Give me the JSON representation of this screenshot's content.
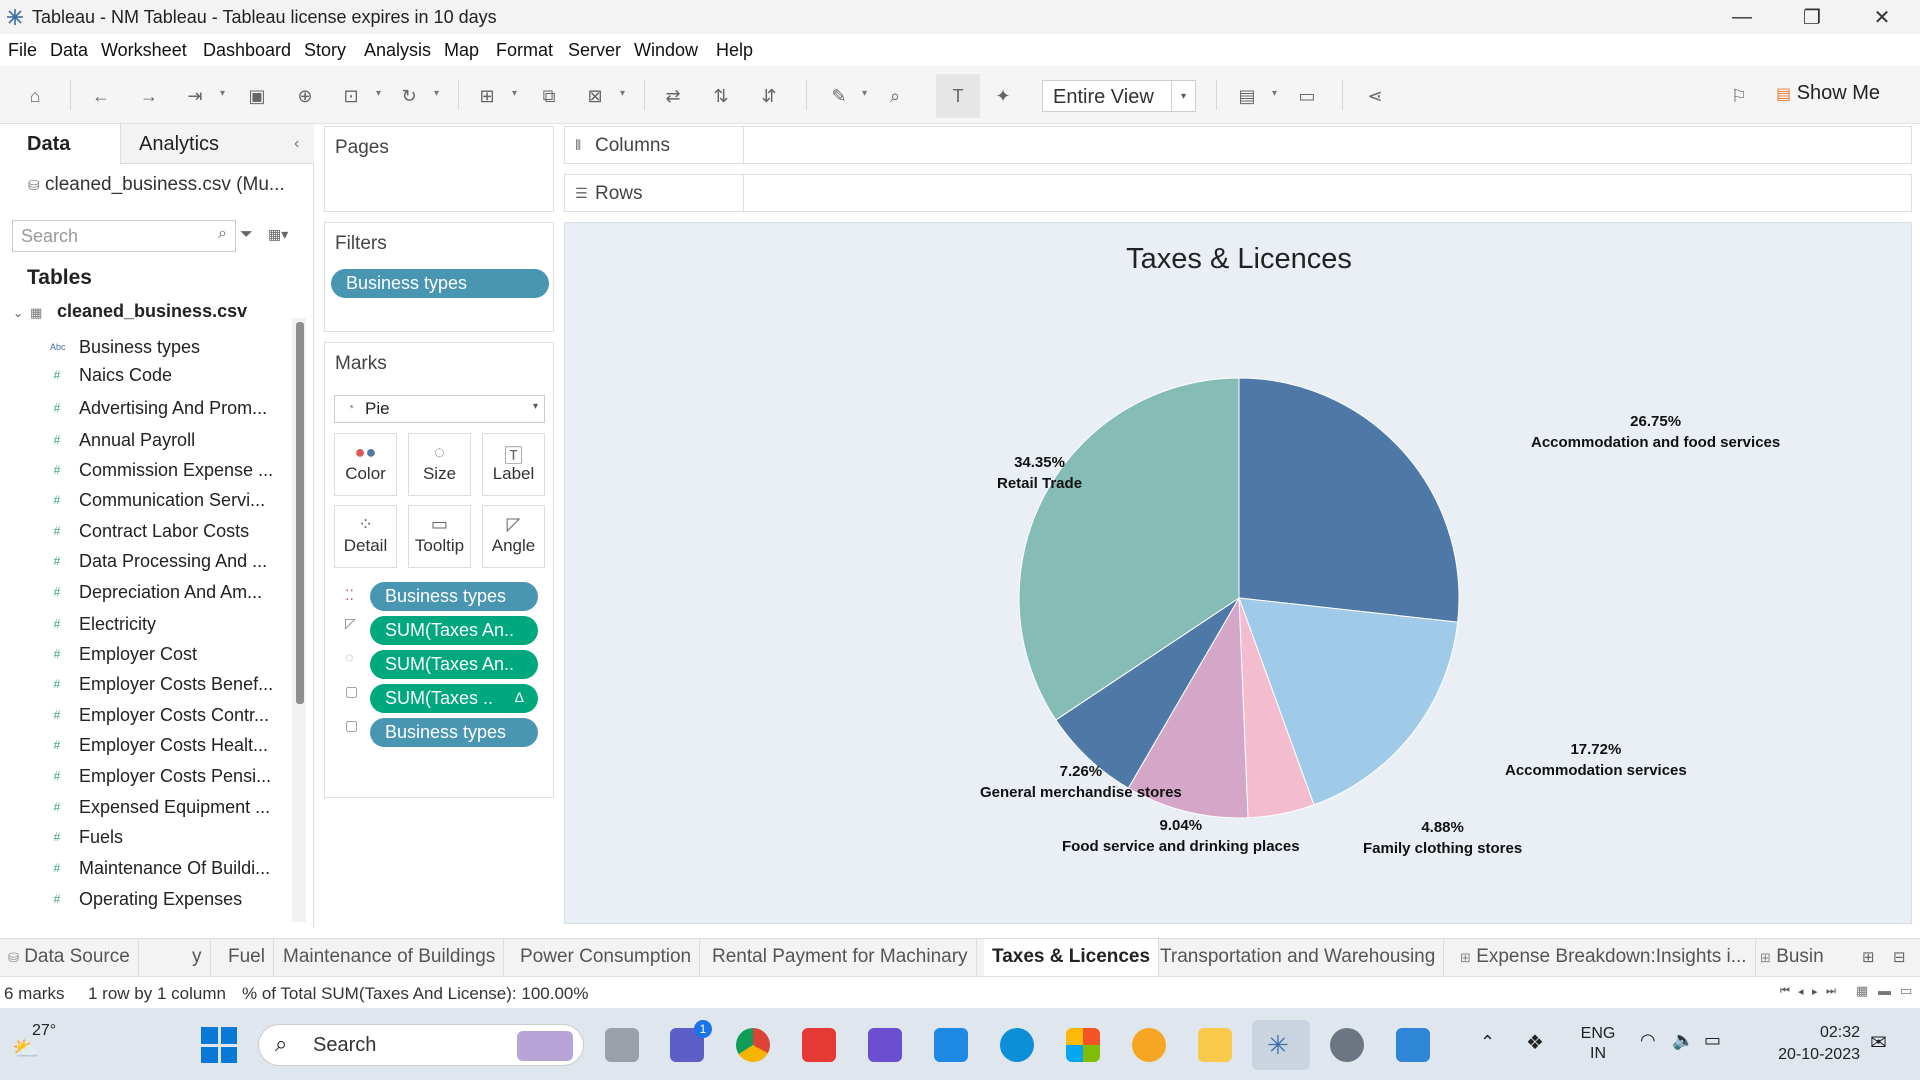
{
  "window": {
    "title": "Tableau - NM Tableau - Tableau license expires in 10 days",
    "minimize": "—",
    "restore": "❐",
    "close": "✕"
  },
  "menu": [
    "File",
    "Data",
    "Worksheet",
    "Dashboard",
    "Story",
    "Analysis",
    "Map",
    "Format",
    "Server",
    "Window",
    "Help"
  ],
  "toolbar": {
    "fit_value": "Entire View",
    "show_me": "Show Me"
  },
  "datapane": {
    "tab_data": "Data",
    "tab_analytics": "Analytics",
    "datasource": "cleaned_business.csv (Mu...",
    "search_placeholder": "Search",
    "tables_title": "Tables",
    "table_name": "cleaned_business.csv",
    "fields": [
      {
        "icon": "Abc",
        "label": "Business types"
      },
      {
        "icon": "#",
        "label": "Naics Code"
      },
      {
        "icon": "#",
        "label": "Advertising And Prom..."
      },
      {
        "icon": "#",
        "label": "Annual Payroll"
      },
      {
        "icon": "#",
        "label": "Commission Expense ..."
      },
      {
        "icon": "#",
        "label": "Communication Servi..."
      },
      {
        "icon": "#",
        "label": "Contract Labor Costs"
      },
      {
        "icon": "#",
        "label": "Data Processing And ..."
      },
      {
        "icon": "#",
        "label": "Depreciation And Am..."
      },
      {
        "icon": "#",
        "label": "Electricity"
      },
      {
        "icon": "#",
        "label": "Employer Cost"
      },
      {
        "icon": "#",
        "label": "Employer Costs Benef..."
      },
      {
        "icon": "#",
        "label": "Employer Costs Contr..."
      },
      {
        "icon": "#",
        "label": "Employer Costs Healt..."
      },
      {
        "icon": "#",
        "label": "Employer Costs Pensi..."
      },
      {
        "icon": "#",
        "label": "Expensed Equipment ..."
      },
      {
        "icon": "#",
        "label": "Fuels"
      },
      {
        "icon": "#",
        "label": "Maintenance Of Buildi..."
      },
      {
        "icon": "#",
        "label": "Operating Expenses"
      }
    ]
  },
  "shelves": {
    "pages": "Pages",
    "filters": "Filters",
    "filter_pill": "Business types",
    "marks": "Marks",
    "mark_type": "Pie",
    "mark_buttons": [
      "Color",
      "Size",
      "Label",
      "Detail",
      "Tooltip",
      "Angle"
    ],
    "mark_pills": [
      {
        "label": "Business types",
        "kind": "blue",
        "icon": "color"
      },
      {
        "label": "SUM(Taxes An..",
        "kind": "green",
        "icon": "angle"
      },
      {
        "label": "SUM(Taxes An..",
        "kind": "green",
        "icon": "size"
      },
      {
        "label": "SUM(Taxes ..",
        "kind": "green",
        "icon": "label",
        "delta": "Δ"
      },
      {
        "label": "Business types",
        "kind": "blue",
        "icon": "label"
      }
    ],
    "columns": "Columns",
    "rows": "Rows"
  },
  "chart_data": {
    "type": "pie",
    "title": "Taxes & Licences",
    "slices": [
      {
        "category": "Accommodation and food services",
        "value": 26.75,
        "label": "26.75%",
        "color": "#4e79a7"
      },
      {
        "category": "Accommodation services",
        "value": 17.72,
        "label": "17.72%",
        "color": "#a0cbe8"
      },
      {
        "category": "Family clothing stores",
        "value": 4.88,
        "label": "4.88%",
        "color": "#f4bccf"
      },
      {
        "category": "Food service and drinking places",
        "value": 9.04,
        "label": "9.04%",
        "color": "#d4a6c8"
      },
      {
        "category": "General merchandise stores",
        "value": 7.26,
        "label": "7.26%",
        "color": "#4e79a7"
      },
      {
        "category": "Retail Trade",
        "value": 34.35,
        "label": "34.35%",
        "color": "#86bcb6"
      }
    ]
  },
  "sheet_tabs": [
    {
      "label": "Data Source",
      "active": false
    },
    {
      "label": "y",
      "active": false
    },
    {
      "label": "Fuel",
      "active": false
    },
    {
      "label": "Maintenance of Buildings",
      "active": false
    },
    {
      "label": "Power Consumption",
      "active": false
    },
    {
      "label": "Rental Payment for Machinary",
      "active": false
    },
    {
      "label": "Taxes & Licences",
      "active": true
    },
    {
      "label": "Transportation and Warehousing",
      "active": false
    },
    {
      "label": "Expense Breakdown:Insights i...",
      "active": false
    },
    {
      "label": "Busin",
      "active": false
    }
  ],
  "status": {
    "marks": "6 marks",
    "dims": "1 row by 1 column",
    "total": "% of Total SUM(Taxes And License): 100.00%"
  },
  "taskbar": {
    "weather": "27°",
    "search": "Search",
    "lang1": "ENG",
    "lang2": "IN",
    "time": "02:32",
    "date": "20-10-2023",
    "chat_badge": "1"
  }
}
